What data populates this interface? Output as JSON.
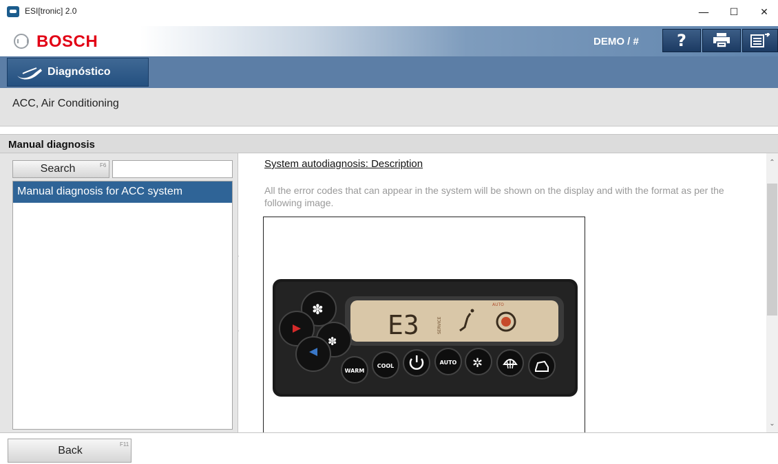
{
  "window": {
    "title": "ESI[tronic] 2.0",
    "minimize_glyph": "—",
    "maximize_glyph": "☐",
    "close_glyph": "✕"
  },
  "brand": {
    "name": "BOSCH",
    "user": "DEMO / #",
    "brand_color": "#e20015"
  },
  "toolbar": {
    "help_icon": "help-icon",
    "print_icon": "printer-icon",
    "menu_icon": "menu-export-icon"
  },
  "nav": {
    "tab_label": "Diagnóstico"
  },
  "breadcrumb": {
    "text": "ACC, Air Conditioning"
  },
  "section": {
    "title": "Manual diagnosis"
  },
  "left": {
    "search_label": "Search",
    "search_fkey": "F6",
    "search_value": "",
    "items": [
      {
        "label": "Manual diagnosis for ACC system",
        "selected": true
      }
    ]
  },
  "content": {
    "title": "System autodiagnosis: Description",
    "body": "All the error codes that can appear in the system will be shown on the display and with the format as per the following image.",
    "display": {
      "code": "E3",
      "service_text": "SERVICE",
      "auto_text": "AUTO",
      "buttons": [
        "WARM",
        "COOL",
        "AUTO"
      ]
    }
  },
  "footer": {
    "back_label": "Back",
    "back_fkey": "F11"
  }
}
